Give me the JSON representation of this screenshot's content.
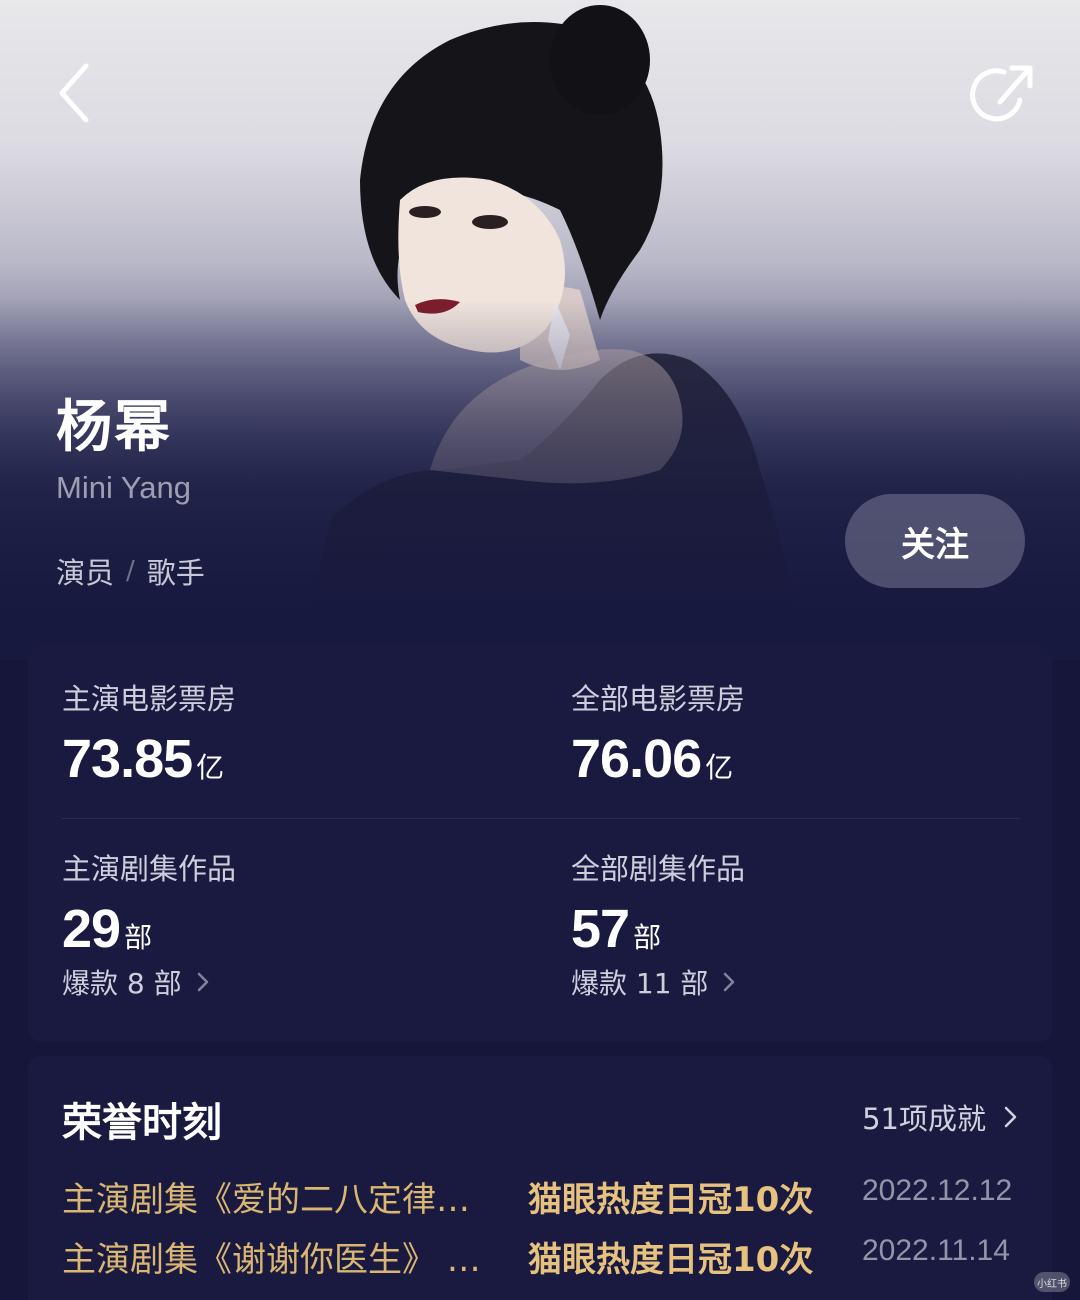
{
  "profile": {
    "name": "杨幂",
    "english_name": "Mini Yang",
    "roles": [
      "演员",
      "歌手"
    ],
    "role_separator": "/",
    "follow_label": "关注"
  },
  "nav": {
    "back_icon": "chevron-left-icon",
    "share_icon": "share-icon"
  },
  "stats": {
    "lead_movie_box": {
      "label": "主演电影票房",
      "value": "73.85",
      "unit": "亿"
    },
    "all_movie_box": {
      "label": "全部电影票房",
      "value": "76.06",
      "unit": "亿"
    },
    "lead_series": {
      "label": "主演剧集作品",
      "value": "29",
      "unit": "部",
      "hits": "爆款 8 部"
    },
    "all_series": {
      "label": "全部剧集作品",
      "value": "57",
      "unit": "部",
      "hits": "爆款 11 部"
    }
  },
  "honors": {
    "title": "荣誉时刻",
    "count_label": "51项成就",
    "items": [
      {
        "work": "主演剧集《爱的二八定律…",
        "achievement": "猫眼热度日冠10次",
        "date": "2022.12.12"
      },
      {
        "work": "主演剧集《谢谢你医生》 …",
        "achievement": "猫眼热度日冠10次",
        "date": "2022.11.14"
      }
    ]
  },
  "colors": {
    "background": "#16163a",
    "card": "#1a1a40",
    "gold": "#d9b671"
  },
  "watermark": "小红书"
}
